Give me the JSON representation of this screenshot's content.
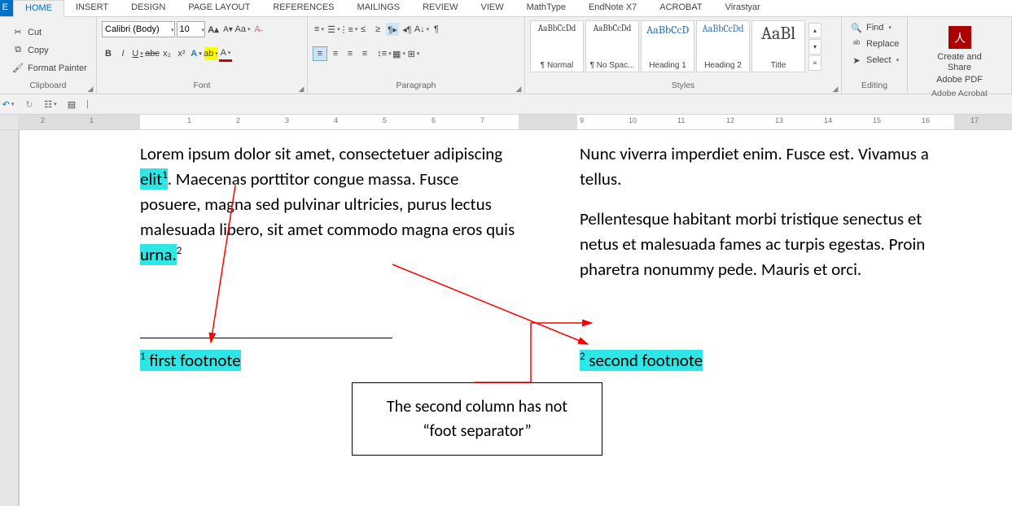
{
  "tabs": {
    "file": "E",
    "list": [
      "HOME",
      "INSERT",
      "DESIGN",
      "PAGE LAYOUT",
      "REFERENCES",
      "MAILINGS",
      "REVIEW",
      "VIEW",
      "MathType",
      "EndNote X7",
      "ACROBAT",
      "Virastyar"
    ],
    "active": 0
  },
  "clipboard": {
    "cut": "Cut",
    "copy": "Copy",
    "fp": "Format Painter",
    "label": "Clipboard"
  },
  "font": {
    "name": "Calibri (Body)",
    "size": "10",
    "label": "Font"
  },
  "paragraph": {
    "label": "Paragraph"
  },
  "styles": {
    "label": "Styles",
    "items": [
      {
        "sample": "AaBbCcDd",
        "name": "¶ Normal",
        "size": 11,
        "color": "#000"
      },
      {
        "sample": "AaBbCcDd",
        "name": "¶ No Spac...",
        "size": 11,
        "color": "#000"
      },
      {
        "sample": "AaBbCcD",
        "name": "Heading 1",
        "size": 14,
        "color": "#2e74b5"
      },
      {
        "sample": "AaBbCcDd",
        "name": "Heading 2",
        "size": 12,
        "color": "#2e74b5"
      },
      {
        "sample": "AaBl",
        "name": "Title",
        "size": 22,
        "color": "#000"
      }
    ]
  },
  "editing": {
    "find": "Find",
    "replace": "Replace",
    "select": "Select",
    "label": "Editing"
  },
  "acrobat": {
    "l1": "Create and Share",
    "l2": "Adobe PDF",
    "label": "Adobe Acrobat"
  },
  "ruler_nums": [
    2,
    1,
    1,
    2,
    3,
    4,
    5,
    6,
    7,
    9,
    10,
    11,
    12,
    13,
    14,
    15,
    16,
    17
  ],
  "doc": {
    "col1_a": "Lorem ipsum dolor sit amet, consectetuer adipiscing ",
    "elit": "elit",
    "sup1": "1",
    "col1_b": ". Maecenas porttitor congue massa. Fusce posuere, magna sed pulvinar ultricies, purus lectus malesuada libero, sit amet commodo magna eros quis ",
    "urna": "urna.",
    "sup2": "2",
    "col2_a": "Nunc viverra imperdiet enim. Fusce est. Vivamus a tellus.",
    "col2_b": "Pellentesque habitant morbi tristique senectus et netus et malesuada fames ac turpis egestas. Proin pharetra nonummy pede. Mauris et orci.",
    "fn1": " first footnote",
    "fn1_num": "1",
    "fn2": " second footnote",
    "fn2_num": "2",
    "callout_a": "The second column has not",
    "callout_b": "“foot separator”"
  }
}
